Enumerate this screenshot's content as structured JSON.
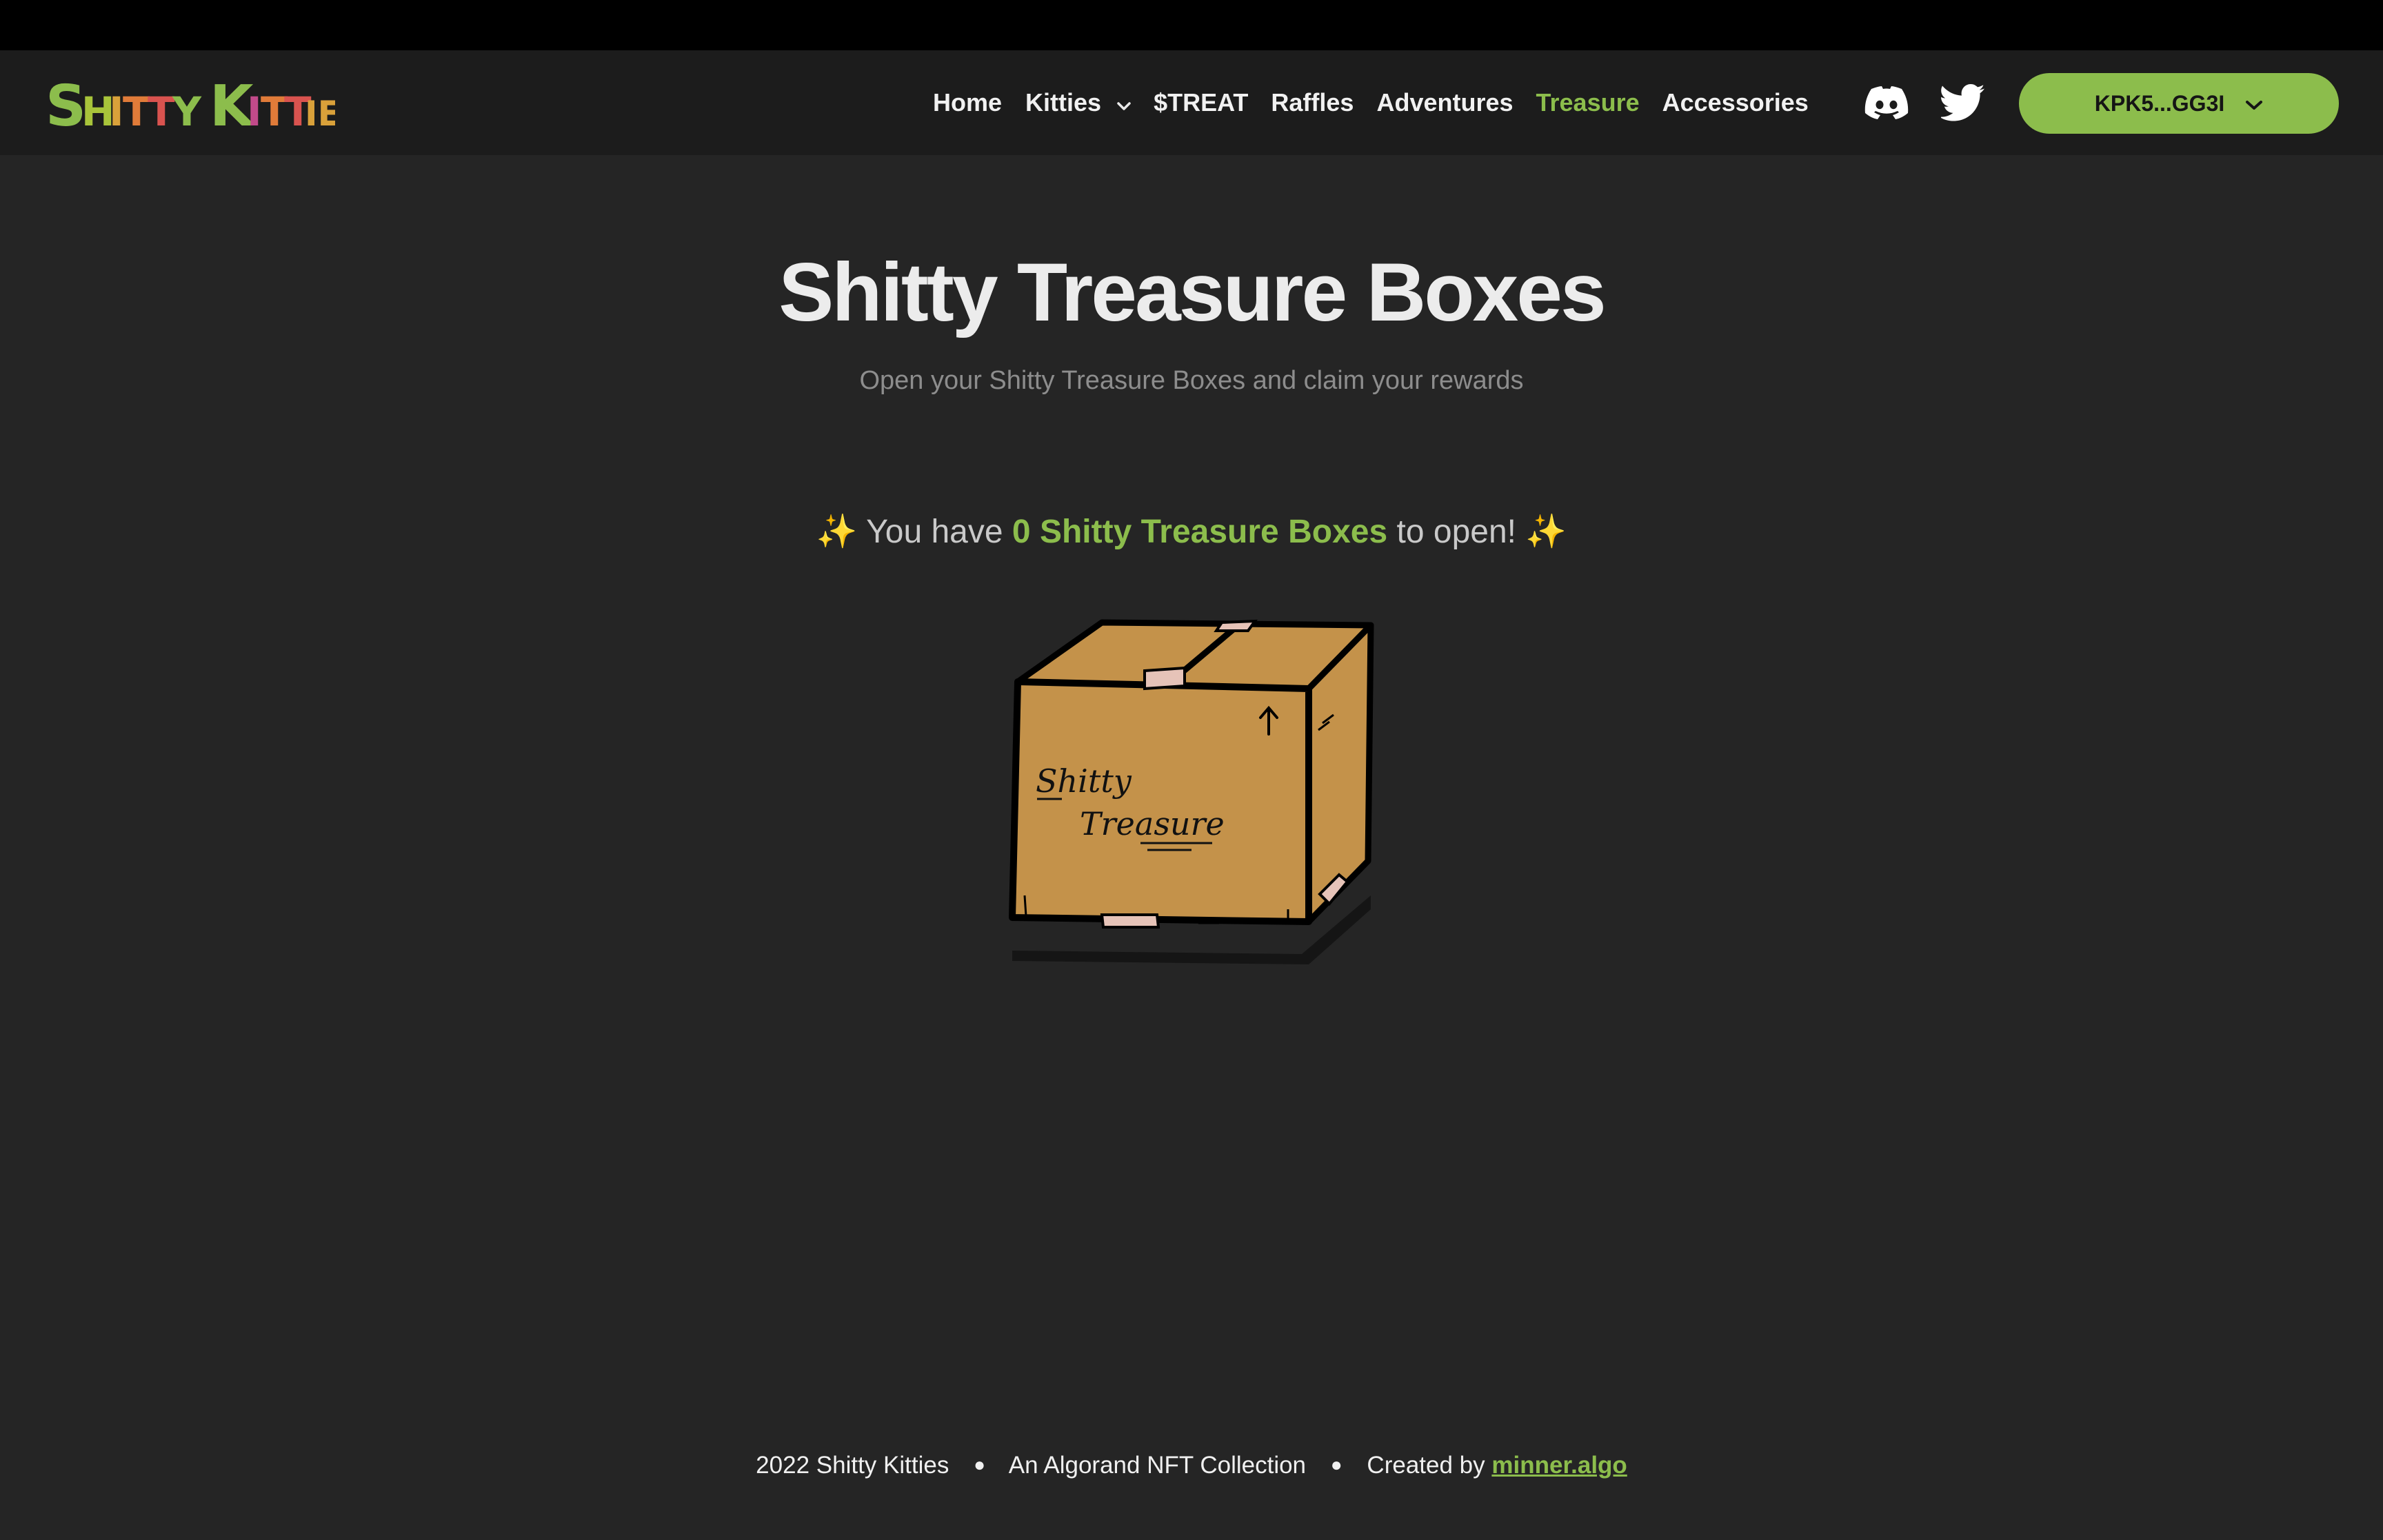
{
  "brand": {
    "logo_text": "Shitty Kitties"
  },
  "nav": {
    "items": [
      {
        "label": "Home"
      },
      {
        "label": "Kitties"
      },
      {
        "label": "$TREAT"
      },
      {
        "label": "Raffles"
      },
      {
        "label": "Adventures"
      },
      {
        "label": "Treasure"
      },
      {
        "label": "Accessories"
      }
    ],
    "social_icons": [
      "discord-icon",
      "twitter-icon"
    ],
    "wallet_label": "KPK5...GG3I"
  },
  "hero": {
    "title": "Shitty Treasure Boxes",
    "subtitle": "Open your Shitty Treasure Boxes and claim your rewards"
  },
  "status": {
    "prefix": "You have",
    "highlight": "0 Shitty Treasure Boxes",
    "suffix": "to open!",
    "sparkle": "✨"
  },
  "box": {
    "line1": "Shitty",
    "line2": "Treasure"
  },
  "footer": {
    "copyright": "2022 Shitty Kitties",
    "tagline": "An Algorand NFT Collection",
    "credit_prefix": "Created by",
    "credit_link": "minner.algo"
  },
  "colors": {
    "accent": "#8cbd4c",
    "background": "#252525",
    "navbar": "#1c1c1c",
    "box": "#c4924a"
  }
}
